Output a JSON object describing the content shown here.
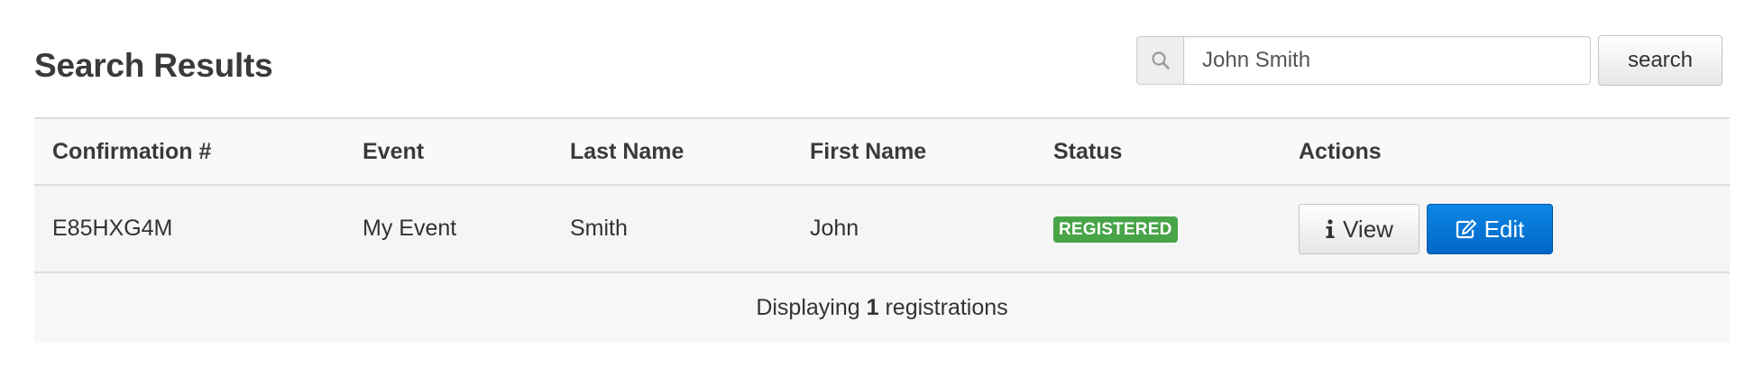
{
  "page_title": "Search Results",
  "search": {
    "value": "John Smith",
    "button_label": "search",
    "icon": "search-icon"
  },
  "table": {
    "headers": [
      "Confirmation #",
      "Event",
      "Last Name",
      "First Name",
      "Status",
      "Actions"
    ],
    "rows": [
      {
        "confirmation": "E85HXG4M",
        "event": "My Event",
        "last_name": "Smith",
        "first_name": "John",
        "status": "REGISTERED",
        "actions": {
          "view_label": "View",
          "view_icon": "info-icon",
          "edit_label": "Edit",
          "edit_icon": "edit-icon"
        }
      }
    ]
  },
  "footer": {
    "prefix": "Displaying",
    "count": "1",
    "suffix": "registrations"
  },
  "colors": {
    "status_registered": "#47a447",
    "edit_button": "#0a7ad8"
  }
}
